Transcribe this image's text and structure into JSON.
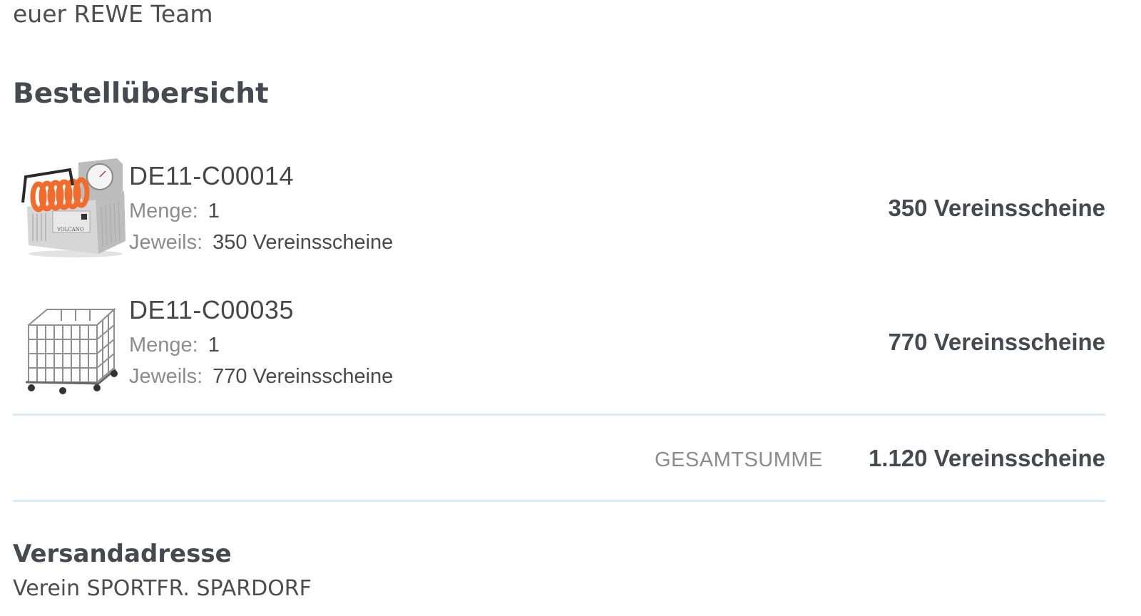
{
  "greeting": "euer REWE Team",
  "overview": {
    "title": "Bestellübersicht",
    "items": [
      {
        "image_icon": "air-pump-compressor-image",
        "code": "DE11-C00014",
        "qty_label": "Menge:",
        "qty_value": "1",
        "each_label": "Jeweils:",
        "each_value": "350 Vereinsscheine",
        "total": "350 Vereinsscheine"
      },
      {
        "image_icon": "wire-ball-cart-image",
        "code": "DE11-C00035",
        "qty_label": "Menge:",
        "qty_value": "1",
        "each_label": "Jeweils:",
        "each_value": "770 Vereinsscheine",
        "total": "770 Vereinsscheine"
      }
    ],
    "sum_label": "GESAMTSUMME",
    "sum_value": "1.120 Vereinsscheine"
  },
  "address": {
    "title": "Versandadresse",
    "line1": "Verein SPORTFR. SPARDORF"
  },
  "colors": {
    "text": "#4a4a4a",
    "muted": "#8c8c8c",
    "divider": "#dcecf5",
    "pump_orange": "#f26b2a",
    "pump_body": "#cfcfcf"
  }
}
